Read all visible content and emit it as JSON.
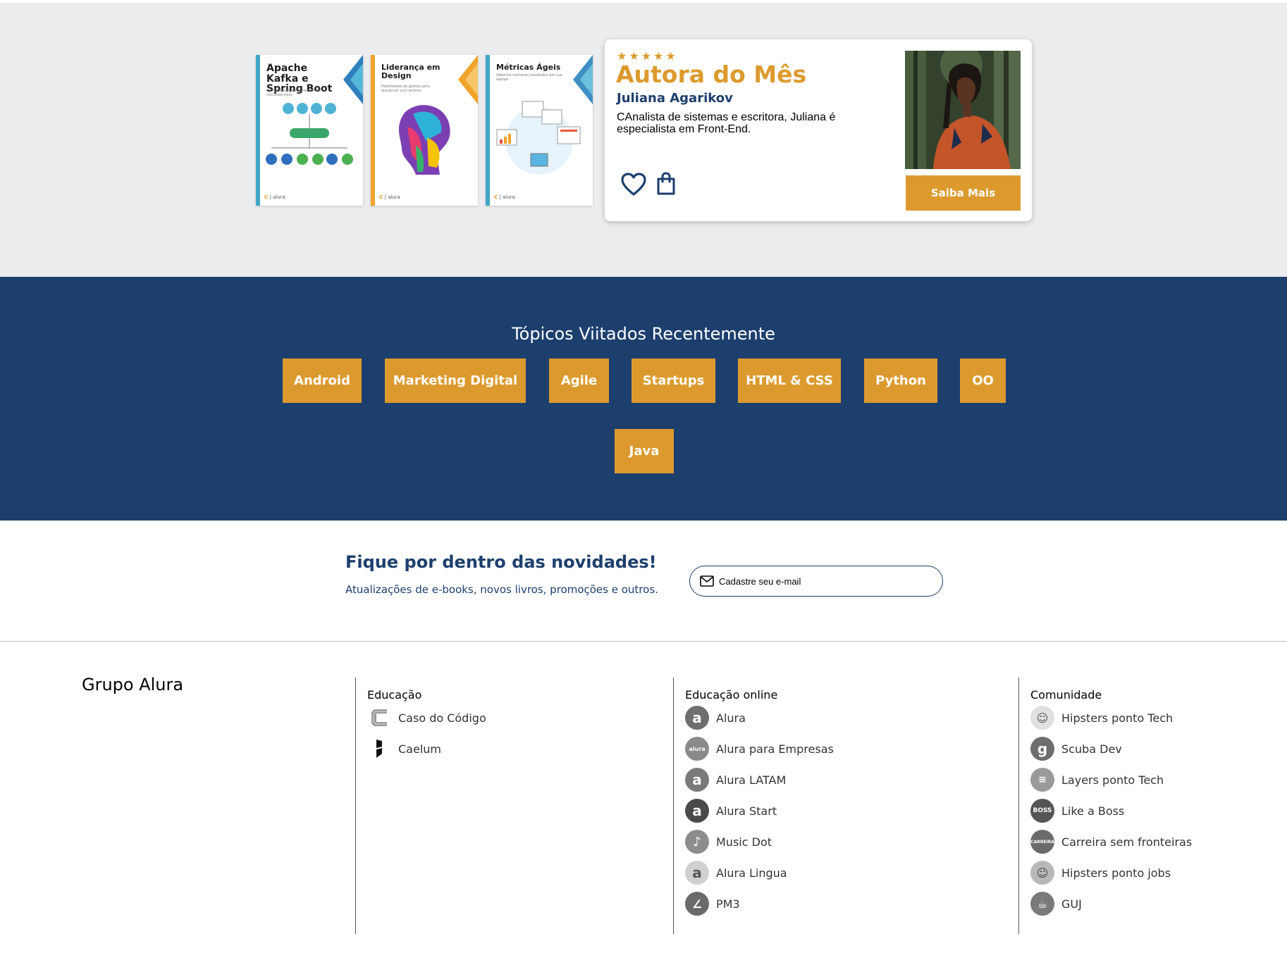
{
  "books": [
    {
      "title": "Apache Kafka e Spring Boot",
      "subtitle": "Comunicação assíncrona entre microsserviços",
      "accent": "#3fa7c4",
      "corner": "#2f7fbd",
      "publisher": "alura"
    },
    {
      "title": "Liderança em Design",
      "subtitle": "Habilidades de gestão para alavancar sua carreira",
      "accent": "#f0a32b",
      "corner": "#f0a32b",
      "publisher": "alura"
    },
    {
      "title": "Métricas Ágeis",
      "subtitle": "Obtenha melhores resultados em sua equipe",
      "accent": "#3fa7c4",
      "corner": "#3f8fc4",
      "publisher": "alura"
    }
  ],
  "author_card": {
    "stars": "★★★★★",
    "heading": "Autora do Mês",
    "name": "Juliana Agarikov",
    "description": "CAnalista de sistemas e escritora, Juliana é especialista em Front-End.",
    "cta_label": "Saiba Mais",
    "favorite_icon": "heart-icon",
    "cart_icon": "shopping-bag-icon"
  },
  "topics": {
    "heading": "Tópicos Viitados Recentemente",
    "tags": [
      "Android",
      "Marketing Digital",
      "Agile",
      "Startups",
      "HTML & CSS",
      "Python",
      "OO",
      "Java"
    ]
  },
  "newsletter": {
    "title": "Fique por dentro das novidades!",
    "subtitle": "Atualizações de e-books, novos livros, promoções e outros.",
    "email_placeholder": "Cadastre seu e-mail"
  },
  "footer": {
    "brand": "Grupo Alura",
    "columns": [
      {
        "title": "Educação",
        "items": [
          "Caso do Código",
          "Caelum"
        ]
      },
      {
        "title": "Educação online",
        "items": [
          "Alura",
          "Alura para Empresas",
          "Alura LATAM",
          "Alura Start",
          "Music Dot",
          "Alura Lingua",
          "PM3"
        ]
      },
      {
        "title": "Comunidade",
        "items": [
          "Hipsters ponto Tech",
          "Scuba Dev",
          "Layers ponto Tech",
          "Like a Boss",
          "Carreira sem fronteiras",
          "Hipsters ponto jobs",
          "GUJ"
        ]
      }
    ]
  },
  "colors": {
    "navy": "#1d3f6e",
    "gold": "#dc9a2e",
    "hero_bg": "#ebeced"
  }
}
